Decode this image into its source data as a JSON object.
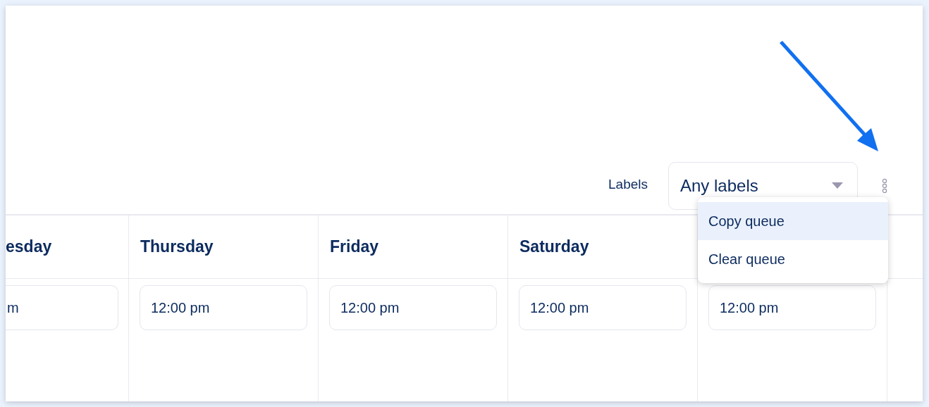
{
  "filter": {
    "label": "Labels",
    "value": "Any labels"
  },
  "menu": {
    "items": [
      {
        "label": "Copy queue",
        "selected": true
      },
      {
        "label": "Clear queue",
        "selected": false
      }
    ]
  },
  "columns": [
    {
      "header": "esday",
      "time": "m"
    },
    {
      "header": "Thursday",
      "time": "12:00 pm"
    },
    {
      "header": "Friday",
      "time": "12:00 pm"
    },
    {
      "header": "Saturday",
      "time": "12:00 pm"
    },
    {
      "time": "12:00 pm"
    }
  ]
}
